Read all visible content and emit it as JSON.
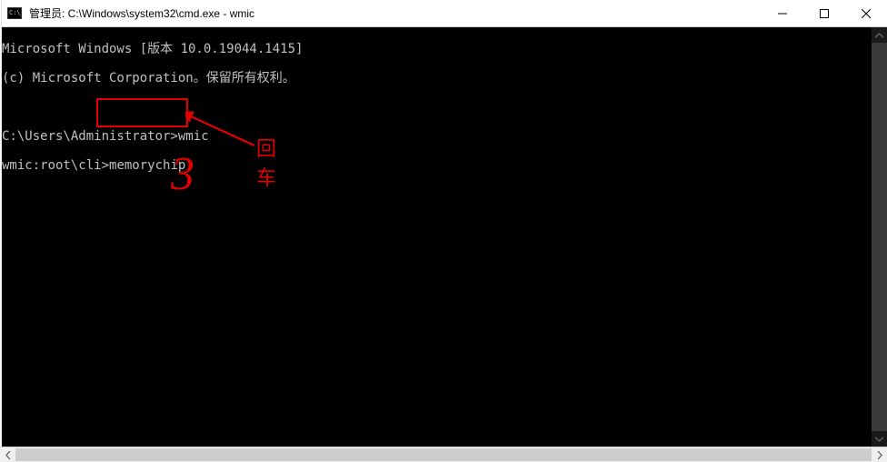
{
  "title": "管理员: C:\\Windows\\system32\\cmd.exe - wmic",
  "lines": {
    "l1": "Microsoft Windows [版本 10.0.19044.1415]",
    "l2": "(c) Microsoft Corporation。保留所有权利。",
    "l3_prompt": "C:\\Users\\Administrator>",
    "l3_cmd": "wmic",
    "l4_prompt": "wmic:root\\cli>",
    "l4_cmd": "memorychip"
  },
  "annotation": {
    "label": "回车",
    "number": "3"
  }
}
